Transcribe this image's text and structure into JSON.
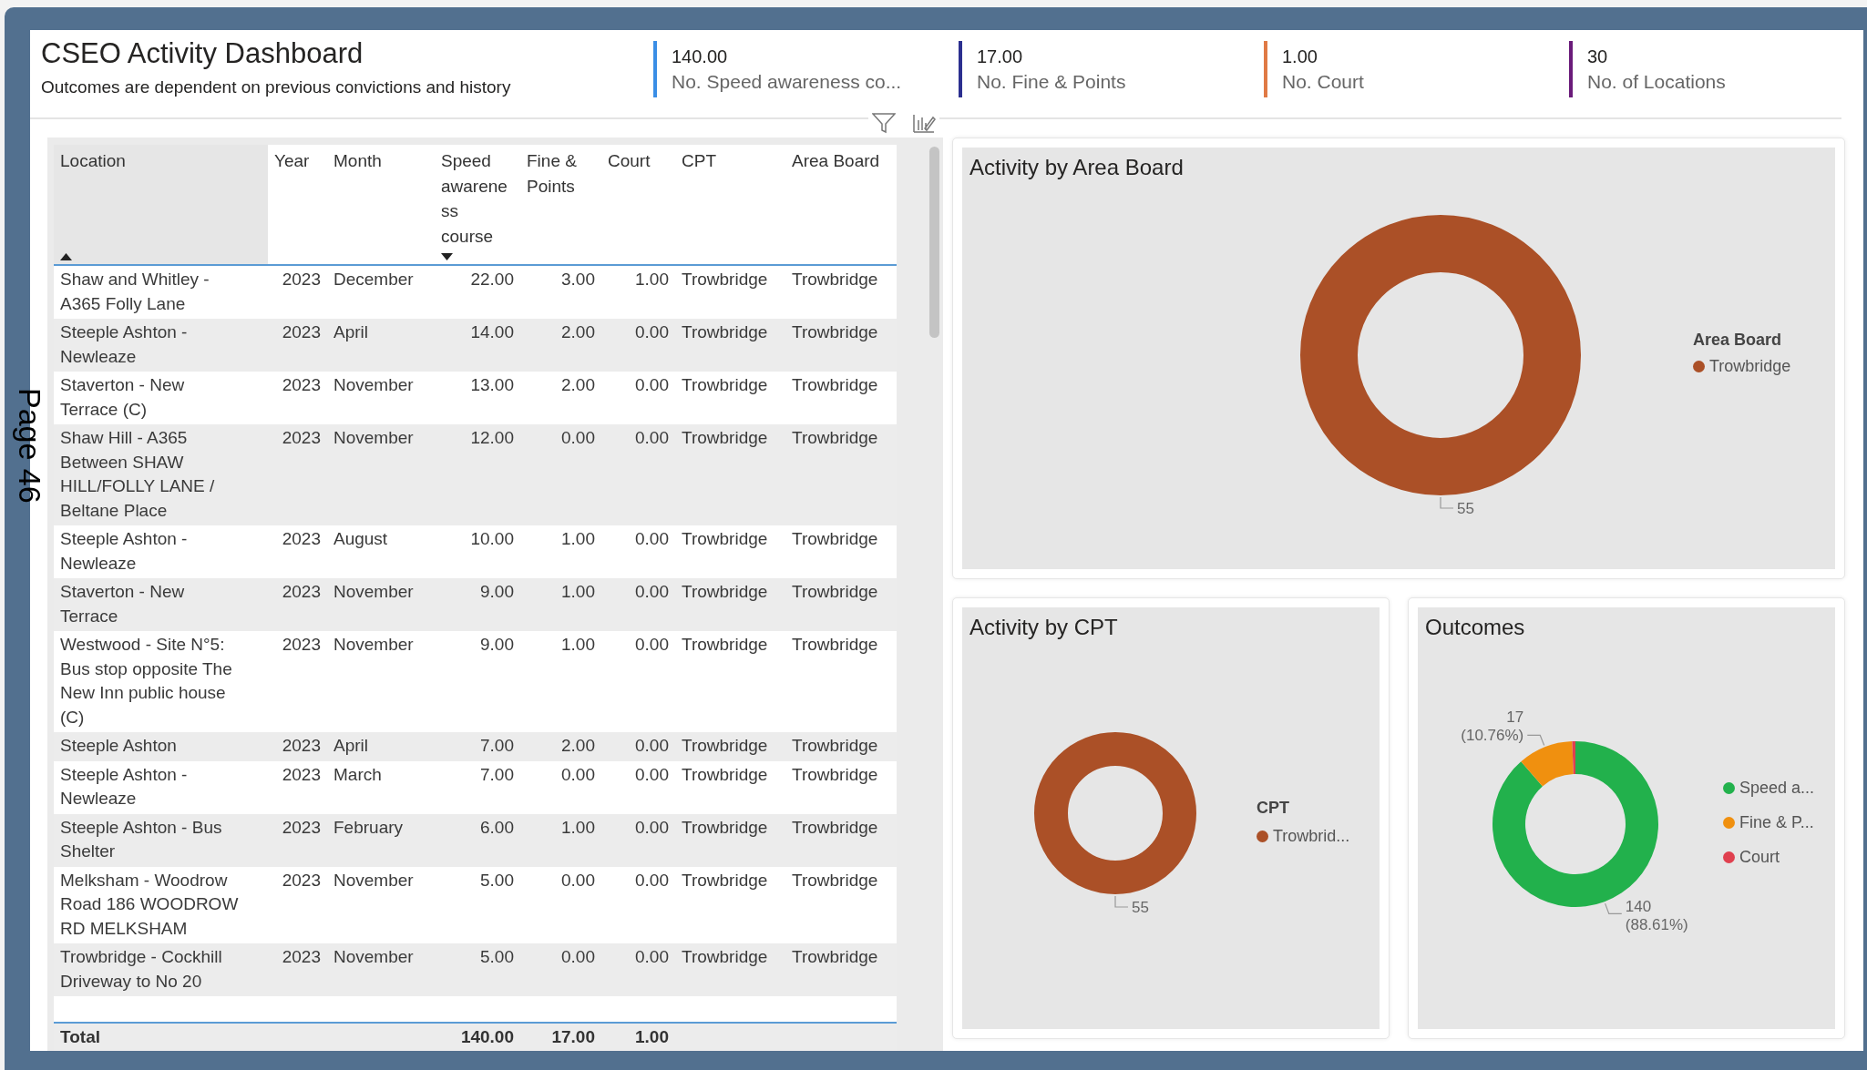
{
  "page_label": "Page 46",
  "header": {
    "title": "CSEO Activity Dashboard",
    "subtitle": "Outcomes are dependent on previous convictions and history"
  },
  "kpis": [
    {
      "value": "140.00",
      "label": "No. Speed awareness co...",
      "color": "#3a8ee6"
    },
    {
      "value": "17.00",
      "label": "No. Fine & Points",
      "color": "#2b2f8f"
    },
    {
      "value": "1.00",
      "label": "No. Court",
      "color": "#e07a45"
    },
    {
      "value": "30",
      "label": "No. of Locations",
      "color": "#6a1b7a"
    }
  ],
  "table": {
    "columns": [
      {
        "label": "Location",
        "kind": "text",
        "sorted_ascending": true,
        "sorted_descending": false
      },
      {
        "label": "Year",
        "kind": "number",
        "sorted_ascending": false,
        "sorted_descending": false
      },
      {
        "label": "Month",
        "kind": "text",
        "sorted_ascending": false,
        "sorted_descending": false
      },
      {
        "label": "Speed awareness course",
        "kind": "number",
        "sorted_ascending": false,
        "sorted_descending": true
      },
      {
        "label": "Fine & Points",
        "kind": "number",
        "sorted_ascending": false,
        "sorted_descending": false
      },
      {
        "label": "Court",
        "kind": "number",
        "sorted_ascending": false,
        "sorted_descending": false
      },
      {
        "label": "CPT",
        "kind": "text",
        "sorted_ascending": false,
        "sorted_descending": false
      },
      {
        "label": "Area Board",
        "kind": "text",
        "sorted_ascending": false,
        "sorted_descending": false
      }
    ],
    "rows": [
      [
        "Shaw and Whitley - A365 Folly Lane",
        "2023",
        "December",
        "22.00",
        "3.00",
        "1.00",
        "Trowbridge",
        "Trowbridge"
      ],
      [
        "Steeple Ashton - Newleaze",
        "2023",
        "April",
        "14.00",
        "2.00",
        "0.00",
        "Trowbridge",
        "Trowbridge"
      ],
      [
        "Staverton - New Terrace (C)",
        "2023",
        "November",
        "13.00",
        "2.00",
        "0.00",
        "Trowbridge",
        "Trowbridge"
      ],
      [
        "Shaw Hill - A365 Between SHAW HILL/FOLLY LANE / Beltane Place",
        "2023",
        "November",
        "12.00",
        "0.00",
        "0.00",
        "Trowbridge",
        "Trowbridge"
      ],
      [
        "Steeple Ashton - Newleaze",
        "2023",
        "August",
        "10.00",
        "1.00",
        "0.00",
        "Trowbridge",
        "Trowbridge"
      ],
      [
        "Staverton - New Terrace",
        "2023",
        "November",
        "9.00",
        "1.00",
        "0.00",
        "Trowbridge",
        "Trowbridge"
      ],
      [
        "Westwood - Site N°5: Bus stop opposite The New Inn public house (C)",
        "2023",
        "November",
        "9.00",
        "1.00",
        "0.00",
        "Trowbridge",
        "Trowbridge"
      ],
      [
        "Steeple Ashton",
        "2023",
        "April",
        "7.00",
        "2.00",
        "0.00",
        "Trowbridge",
        "Trowbridge"
      ],
      [
        "Steeple Ashton - Newleaze",
        "2023",
        "March",
        "7.00",
        "0.00",
        "0.00",
        "Trowbridge",
        "Trowbridge"
      ],
      [
        "Steeple Ashton - Bus Shelter",
        "2023",
        "February",
        "6.00",
        "1.00",
        "0.00",
        "Trowbridge",
        "Trowbridge"
      ],
      [
        "Melksham - Woodrow Road 186 WOODROW RD MELKSHAM",
        "2023",
        "November",
        "5.00",
        "0.00",
        "0.00",
        "Trowbridge",
        "Trowbridge"
      ],
      [
        "Trowbridge - Cockhill Driveway to No 20",
        "2023",
        "November",
        "5.00",
        "0.00",
        "0.00",
        "Trowbridge",
        "Trowbridge"
      ]
    ],
    "total": {
      "label": "Total",
      "speed_awareness": "140.00",
      "fine_points": "17.00",
      "court": "1.00"
    }
  },
  "area_board_chart": {
    "title": "Activity by Area Board",
    "ring_label": "55",
    "legend": {
      "title": "Area Board",
      "items": [
        {
          "label": "Trowbridge",
          "color": "#ab5027"
        }
      ]
    }
  },
  "cpt_chart": {
    "title": "Activity by CPT",
    "ring_label": "55",
    "legend": {
      "title": "CPT",
      "items": [
        {
          "label": "Trowbrid...",
          "color": "#ab5027"
        }
      ]
    }
  },
  "outcomes_chart": {
    "title": "Outcomes",
    "legend": {
      "items": [
        {
          "color": "#22b14c"
        },
        {
          "color": "#f0900f"
        },
        {
          "color": "#e0404f"
        }
      ]
    },
    "chart_data": {
      "type": "donut",
      "categories": [
        "Speed a...",
        "Fine & P...",
        "Court"
      ],
      "values": [
        140,
        17,
        1
      ],
      "value_labels": [
        "140 (88.61%)",
        "17 (10.76%)",
        null
      ],
      "legend": "right"
    }
  }
}
